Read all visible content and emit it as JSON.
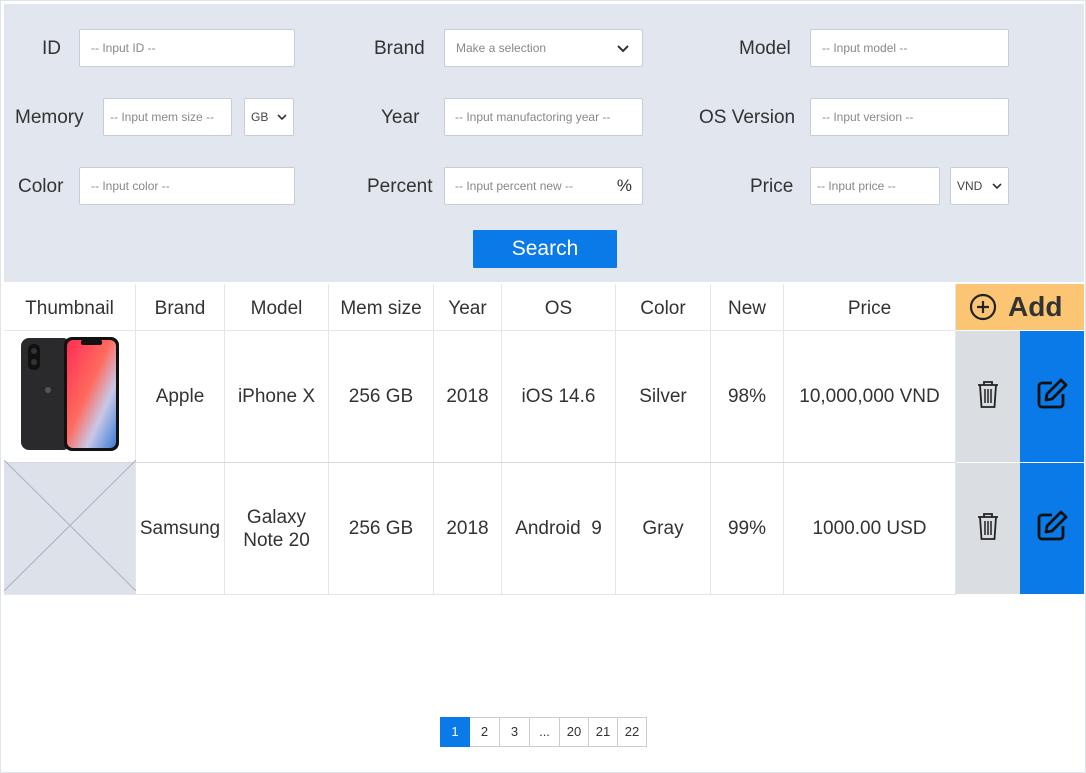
{
  "filters": {
    "id": {
      "label": "ID",
      "placeholder": "-- Input ID --"
    },
    "brand": {
      "label": "Brand",
      "value": "Make a selection"
    },
    "model": {
      "label": "Model",
      "placeholder": "-- Input model --"
    },
    "memory": {
      "label": "Memory",
      "placeholder": "-- Input mem size --",
      "unit": "GB"
    },
    "year": {
      "label": "Year",
      "placeholder": "-- Input manufactoring year --"
    },
    "os_version": {
      "label": "OS Version",
      "placeholder": "-- Input version --"
    },
    "color": {
      "label": "Color",
      "placeholder": "-- Input color --"
    },
    "percent": {
      "label": "Percent",
      "placeholder": "-- Input percent new --",
      "suffix": "%"
    },
    "price": {
      "label": "Price",
      "placeholder": "-- Input price --",
      "currency": "VND"
    },
    "search_label": "Search"
  },
  "table": {
    "headers": [
      "Thumbnail",
      "Brand",
      "Model",
      "Mem size",
      "Year",
      "OS",
      "Color",
      "New",
      "Price"
    ],
    "add_label": "Add",
    "rows": [
      {
        "brand": "Apple",
        "model": "iPhone X",
        "mem": "256 GB",
        "year": "2018",
        "os": "iOS 14.6",
        "color": "Silver",
        "new": "98%",
        "price": "10,000,000 VND"
      },
      {
        "brand": "Samsung",
        "model": "Galaxy Note 20",
        "mem": "256 GB",
        "year": "2018",
        "os": "Android  9",
        "color": "Gray",
        "new": "99%",
        "price": "1000.00 USD"
      }
    ]
  },
  "pagination": {
    "pages": [
      "1",
      "2",
      "3",
      "...",
      "20",
      "21",
      "22"
    ],
    "current": "1"
  },
  "icons": {
    "add": "plus-circle-icon",
    "delete": "trash-icon",
    "edit": "edit-icon",
    "dropdown": "chevron-down-icon"
  },
  "colors": {
    "accent": "#0a7ae8",
    "add_bg": "#fcc574",
    "filter_bg": "#e1e6ef",
    "delete_bg": "#dadde1"
  }
}
